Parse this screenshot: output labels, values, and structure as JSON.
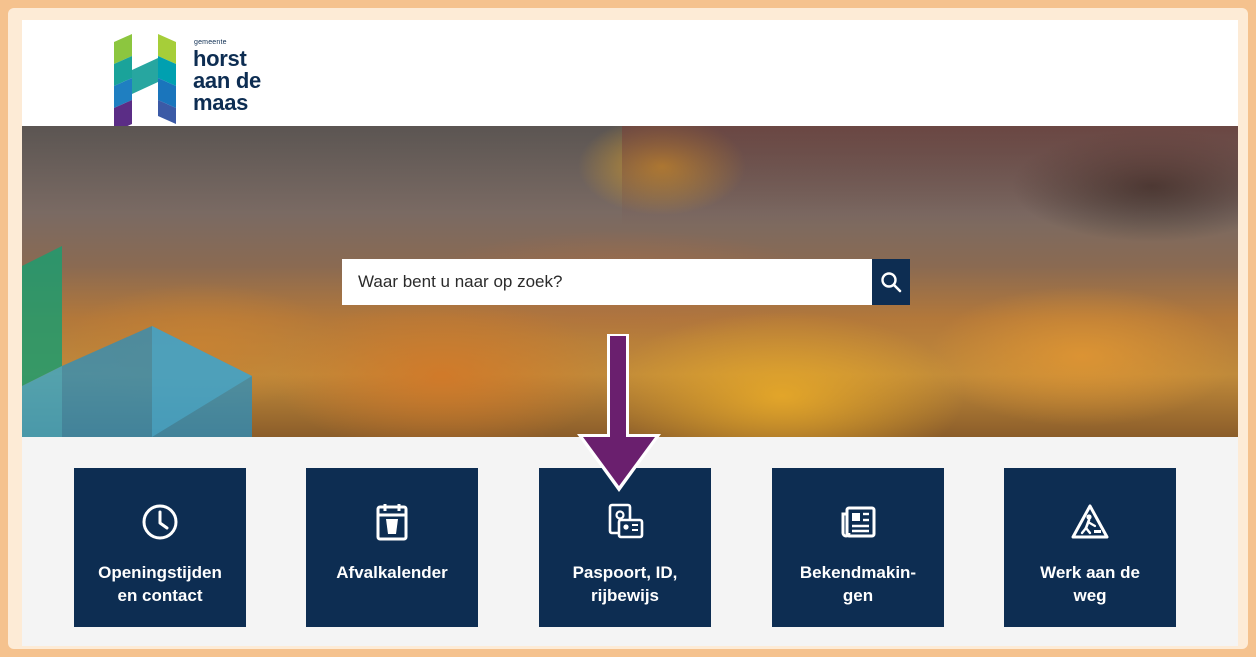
{
  "logo": {
    "small_text": "gemeente",
    "line1": "horst",
    "line2": "aan de",
    "line3": "maas"
  },
  "search": {
    "placeholder": "Waar bent u naar op zoek?",
    "button_icon": "search-icon"
  },
  "tiles": [
    {
      "label": "Openingstijden\nen contact",
      "icon": "clock-icon"
    },
    {
      "label": "Afvalkalender",
      "icon": "waste-calendar-icon"
    },
    {
      "label": "Paspoort, ID,\nrijbewijs",
      "icon": "id-card-icon"
    },
    {
      "label": "Bekendmakin-\ngen",
      "icon": "newspaper-icon"
    },
    {
      "label": "Werk aan de\nweg",
      "icon": "road-work-icon"
    }
  ],
  "annotation": {
    "arrow_color": "#6a1f6e",
    "frame_color": "#f5c28e"
  },
  "colors": {
    "brand_navy": "#0d2d52"
  }
}
